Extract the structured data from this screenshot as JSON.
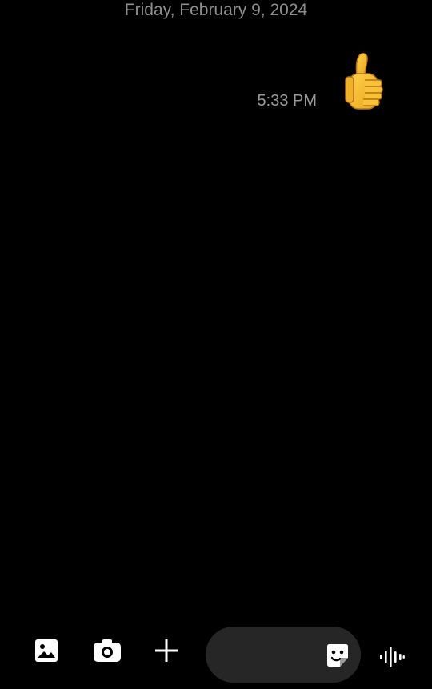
{
  "conversation": {
    "date_header": "Friday, February 9, 2024",
    "messages": [
      {
        "type": "emoji",
        "emoji": "thumbs-up",
        "time": "5:33 PM",
        "sender": "me"
      }
    ]
  },
  "composer": {
    "input_value": "",
    "icons": [
      "gallery-icon",
      "camera-icon",
      "plus-icon",
      "sticker-icon",
      "voice-waveform-icon"
    ]
  },
  "colors": {
    "background": "#000000",
    "secondary_text": "#8e8e8e",
    "input_pill": "#262626",
    "icon": "#ffffff"
  }
}
